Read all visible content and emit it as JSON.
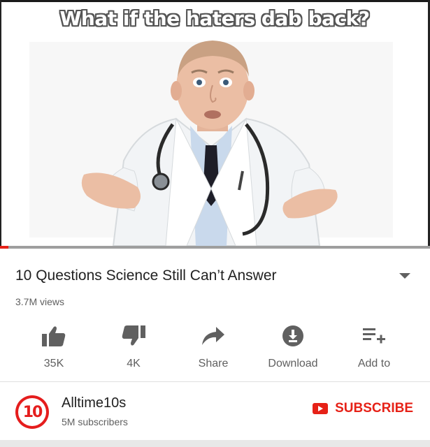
{
  "player": {
    "meme_caption": "What if the haters dab back?",
    "thumbnail_subject": "doctor-shrugging",
    "progress_fraction": 0.02
  },
  "video": {
    "title": "10 Questions Science Still Can’t Answer",
    "views": "3.7M views"
  },
  "actions": [
    {
      "icon": "thumbs-up-icon",
      "label": "35K"
    },
    {
      "icon": "thumbs-down-icon",
      "label": "4K"
    },
    {
      "icon": "share-icon",
      "label": "Share"
    },
    {
      "icon": "download-icon",
      "label": "Download"
    },
    {
      "icon": "add-to-playlist-icon",
      "label": "Add to"
    }
  ],
  "channel": {
    "avatar_text": "10",
    "name": "Alltime10s",
    "subscribers": "5M subscribers",
    "subscribe_label": "SUBSCRIBE"
  },
  "colors": {
    "accent": "#e62117",
    "avatar": "#e51d1d",
    "icon": "#606060"
  }
}
